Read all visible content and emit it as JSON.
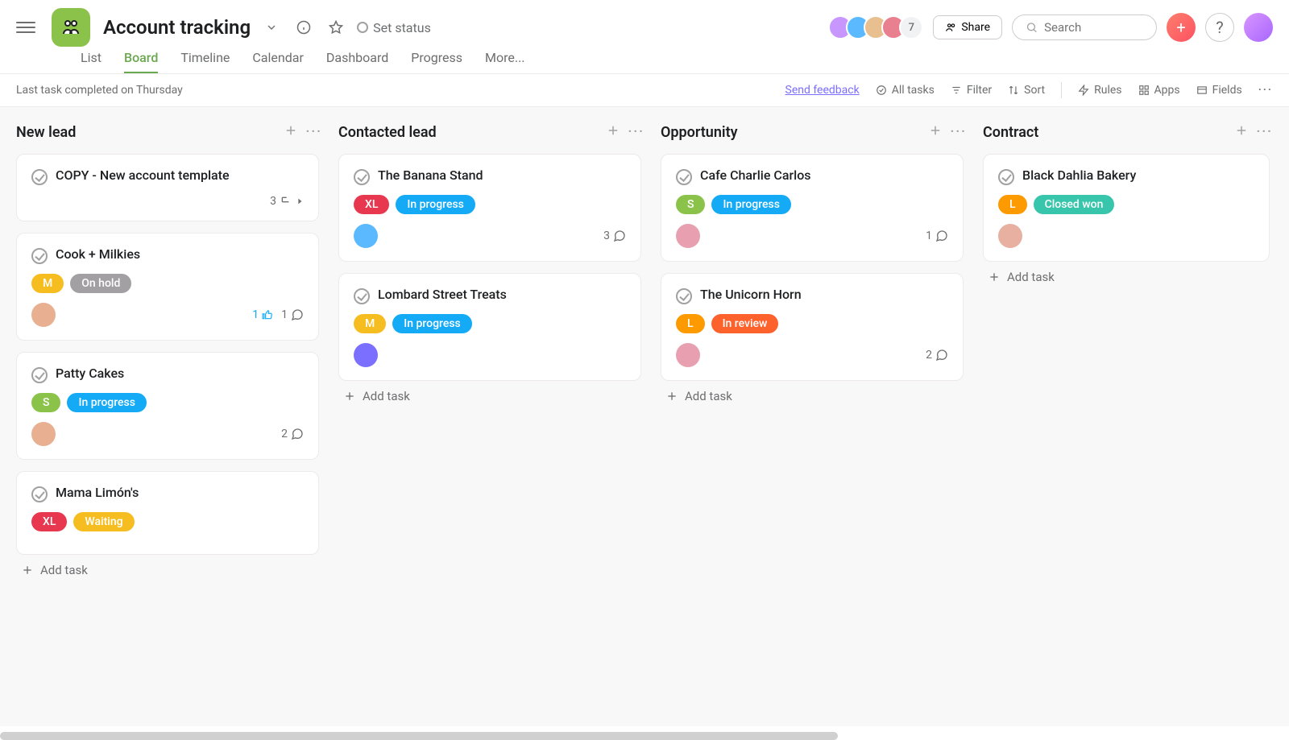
{
  "header": {
    "title": "Account tracking",
    "setStatus": "Set status",
    "share": "Share",
    "searchPlaceholder": "Search",
    "avatarExtra": "7",
    "avatars": [
      "#c896ff",
      "#5bb9ff",
      "#e8c090",
      "#e88090"
    ]
  },
  "tabs": [
    "List",
    "Board",
    "Timeline",
    "Calendar",
    "Dashboard",
    "Progress",
    "More..."
  ],
  "activeTab": "Board",
  "subbar": {
    "status": "Last task completed on Thursday",
    "feedback": "Send feedback",
    "items": [
      "All tasks",
      "Filter",
      "Sort",
      "Rules",
      "Apps",
      "Fields"
    ]
  },
  "columns": [
    {
      "name": "New lead",
      "addTask": "Add task",
      "cards": [
        {
          "title": "COPY - New account template",
          "tags": [],
          "assignee": null,
          "subtasks": "3",
          "comments": null,
          "likes": null
        },
        {
          "title": "Cook + Milkies",
          "tags": [
            {
              "size": "M"
            },
            {
              "status": "On hold",
              "cls": "status-hold"
            }
          ],
          "assignee": "#e8b090",
          "comments": "1",
          "likes": "1"
        },
        {
          "title": "Patty Cakes",
          "tags": [
            {
              "size": "S"
            },
            {
              "status": "In progress",
              "cls": "status-progress"
            }
          ],
          "assignee": "#e8b090",
          "comments": "2"
        },
        {
          "title": "Mama Limón's",
          "tags": [
            {
              "size": "XL"
            },
            {
              "status": "Waiting",
              "cls": "status-waiting"
            }
          ],
          "assignee": null
        }
      ]
    },
    {
      "name": "Contacted lead",
      "addTask": "Add task",
      "cards": [
        {
          "title": "The Banana Stand",
          "tags": [
            {
              "size": "XL"
            },
            {
              "status": "In progress",
              "cls": "status-progress"
            }
          ],
          "assignee": "#5bb9ff",
          "comments": "3"
        },
        {
          "title": "Lombard Street Treats",
          "tags": [
            {
              "size": "M"
            },
            {
              "status": "In progress",
              "cls": "status-progress"
            }
          ],
          "assignee": "#7b6fff"
        }
      ]
    },
    {
      "name": "Opportunity",
      "addTask": "Add task",
      "cards": [
        {
          "title": "Cafe Charlie Carlos",
          "tags": [
            {
              "size": "S"
            },
            {
              "status": "In progress",
              "cls": "status-progress"
            }
          ],
          "assignee": "#e8a0b0",
          "comments": "1"
        },
        {
          "title": "The Unicorn Horn",
          "tags": [
            {
              "size": "L"
            },
            {
              "status": "In review",
              "cls": "status-review"
            }
          ],
          "assignee": "#e8a0b0",
          "comments": "2"
        }
      ]
    },
    {
      "name": "Contract",
      "addTask": "Add task",
      "cards": [
        {
          "title": "Black Dahlia Bakery",
          "tags": [
            {
              "size": "L"
            },
            {
              "status": "Closed won",
              "cls": "status-closed"
            }
          ],
          "assignee": "#e8b0a0"
        }
      ]
    }
  ]
}
